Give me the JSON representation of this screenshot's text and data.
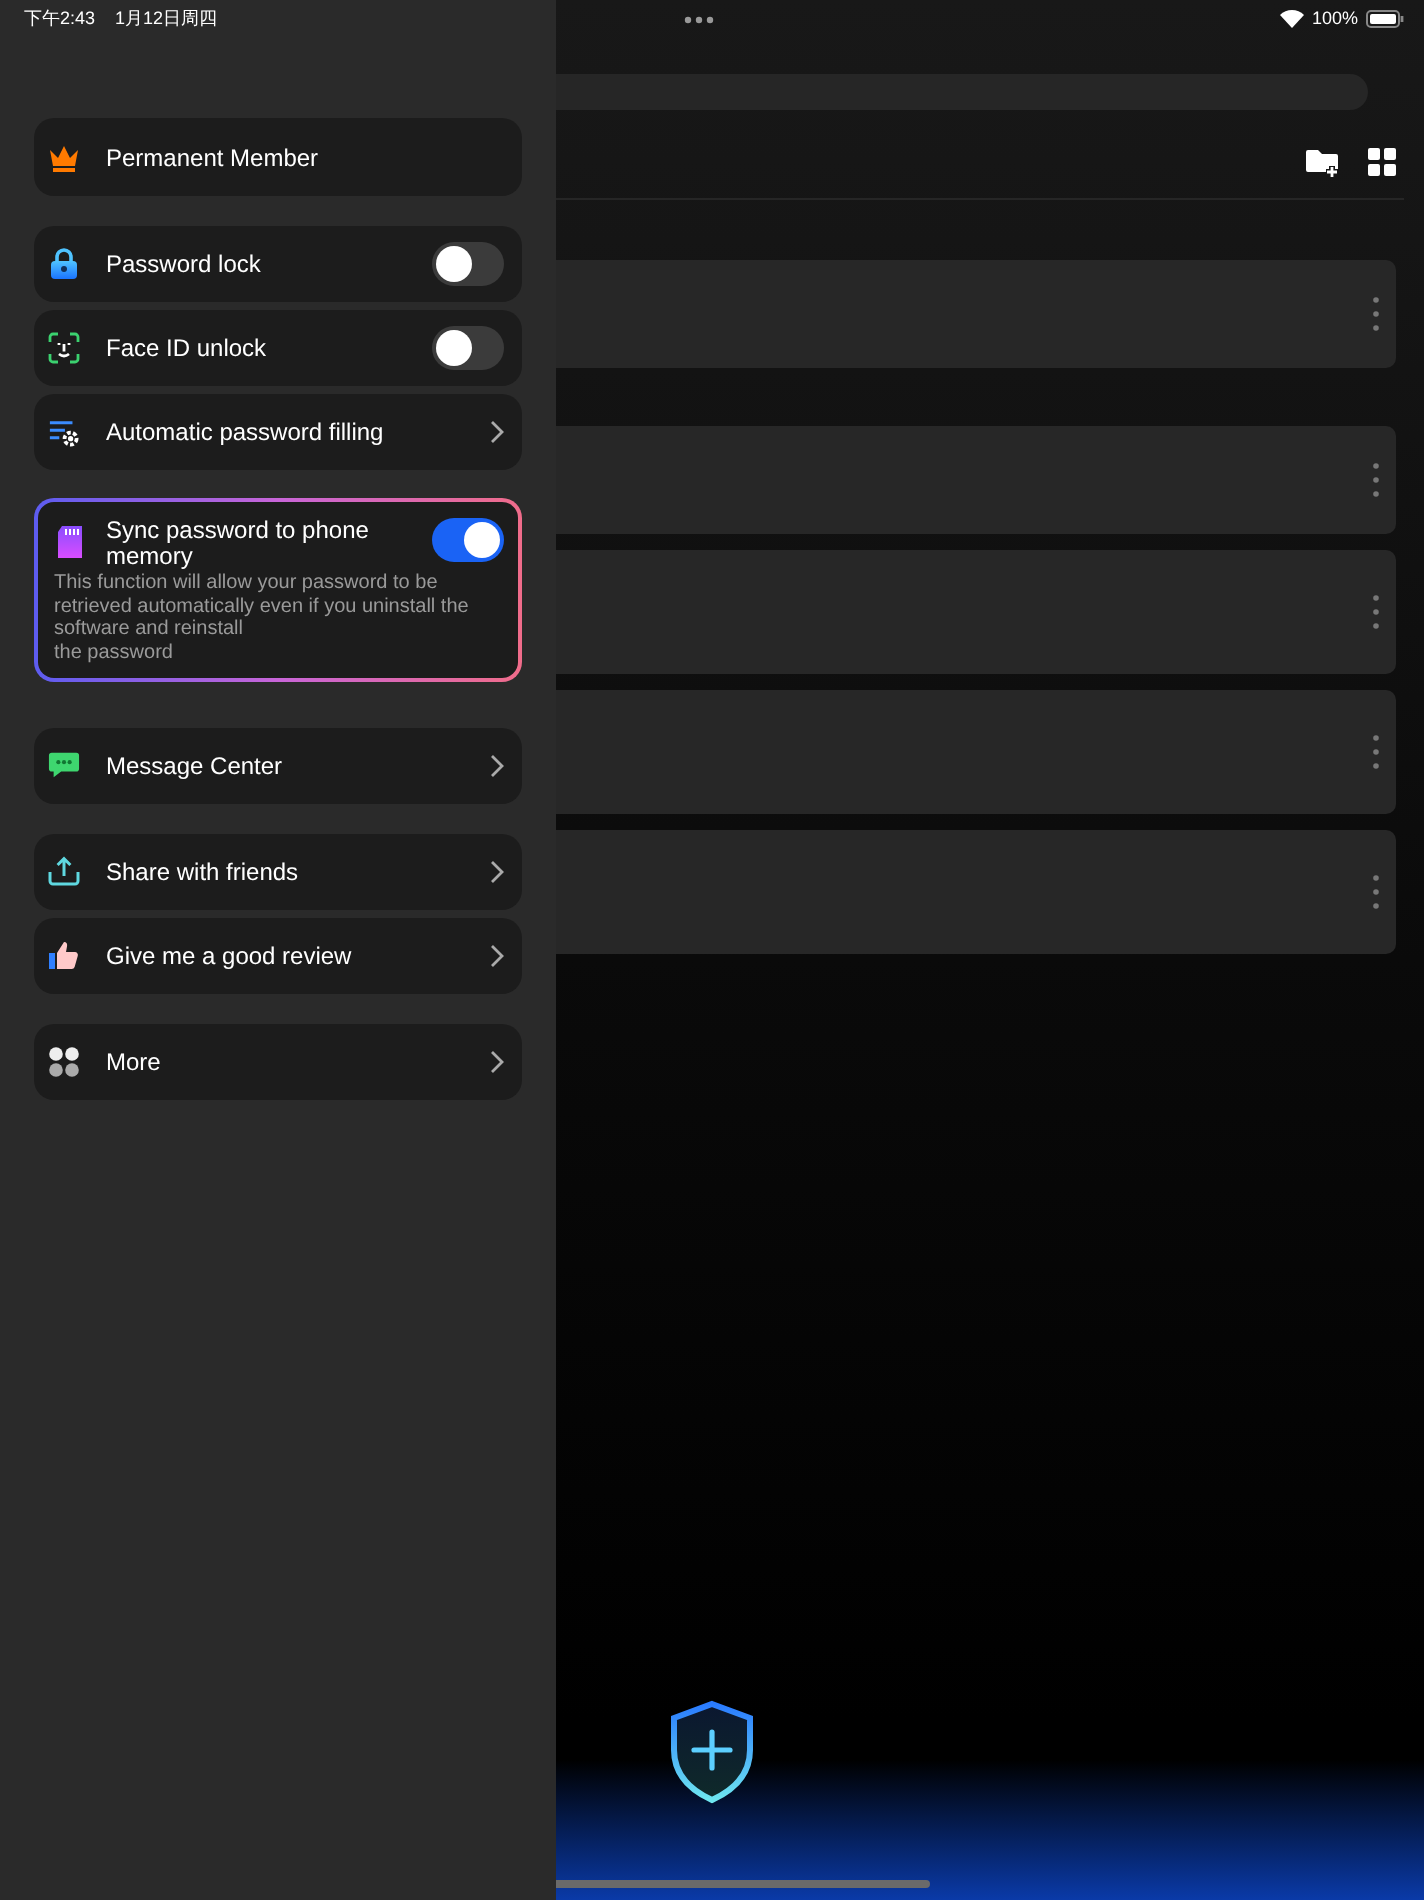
{
  "status_bar": {
    "time": "下午2:43",
    "date": "1月12日周四",
    "battery": "100%"
  },
  "drawer": {
    "groups": [
      [
        {
          "kind": "plain",
          "label": "Permanent Member"
        }
      ],
      [
        {
          "kind": "toggle",
          "label": "Password lock",
          "on": false
        },
        {
          "kind": "toggle",
          "label": "Face ID unlock",
          "on": false
        },
        {
          "kind": "link",
          "label": "Automatic password filling"
        }
      ],
      [
        {
          "kind": "sync",
          "label": "Sync password to phone memory",
          "on": true,
          "description": "This function will allow your password to be retrieved automatically even if you uninstall the software and reinstall\nthe password"
        }
      ],
      [
        {
          "kind": "link",
          "label": "Message Center"
        }
      ],
      [
        {
          "kind": "link",
          "label": "Share with friends"
        },
        {
          "kind": "link",
          "label": "Give me a good review"
        }
      ],
      [
        {
          "kind": "link",
          "label": "More"
        }
      ]
    ]
  },
  "main": {
    "cards": [
      {
        "kind": "entry"
      },
      {
        "kind": "entry"
      },
      {
        "kind": "entry"
      },
      {
        "kind": "entry"
      },
      {
        "kind": "entry"
      }
    ]
  }
}
